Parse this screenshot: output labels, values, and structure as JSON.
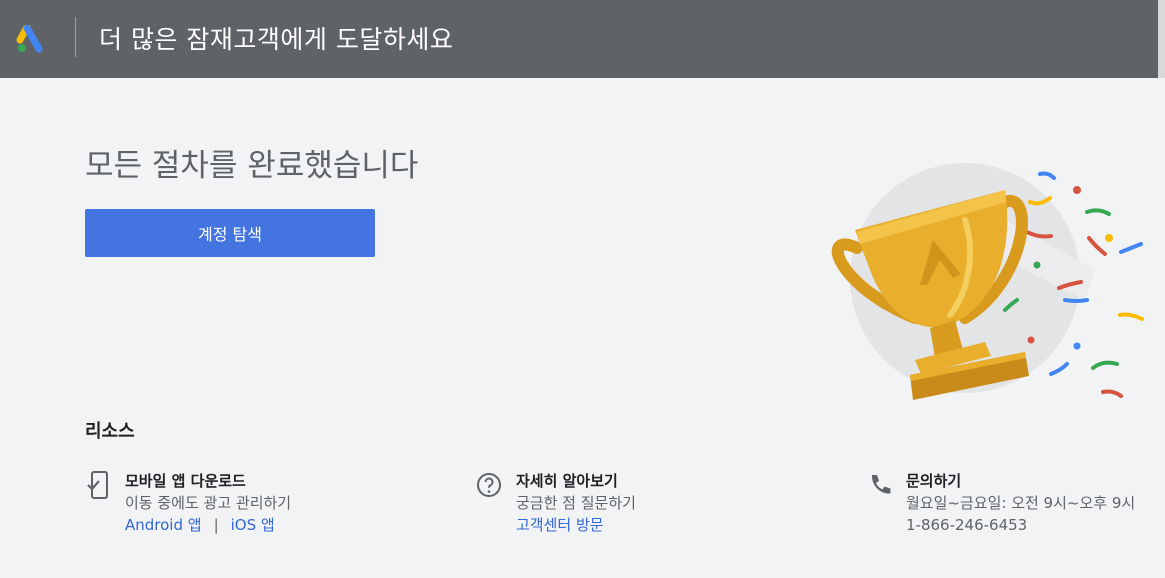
{
  "header": {
    "title": "더 많은 잠재고객에게 도달하세요"
  },
  "main": {
    "heading": "모든 절차를 완료했습니다",
    "cta_label": "계정 탐색"
  },
  "resources": {
    "title": "리소스",
    "mobile": {
      "title": "모바일 앱 다운로드",
      "subtitle": "이동 중에도 광고 관리하기",
      "android_link": "Android 앱",
      "separator": "|",
      "ios_link": "iOS 앱"
    },
    "learn": {
      "title": "자세히 알아보기",
      "subtitle": "궁금한 점 질문하기",
      "link": "고객센터 방문"
    },
    "contact": {
      "title": "문의하기",
      "hours": "월요일~금요일: 오전 9시~오후 9시",
      "phone": "1-866-246-6453"
    }
  },
  "colors": {
    "header_bg": "#5f6368",
    "cta_bg": "#4374e0",
    "link": "#3367d6",
    "trophy": "#e0a526"
  },
  "icons": {
    "logo": "google-ads-logo",
    "mobile": "phone-check-icon",
    "help": "help-circle-icon",
    "contact": "phone-icon",
    "illustration": "trophy-illustration"
  }
}
